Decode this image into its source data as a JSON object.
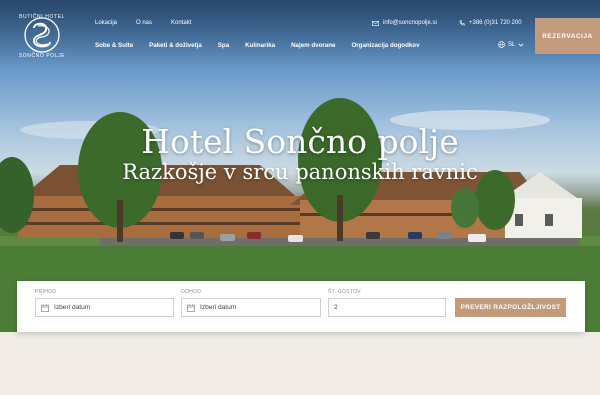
{
  "brand": {
    "logo_top": "Butični hotel",
    "logo_bottom": "Sončno polje"
  },
  "top_links": [
    "Lokacija",
    "O nas",
    "Kontakt"
  ],
  "contact": {
    "email": "info@soncnopolje.si",
    "phone": "+386 (0)31 720 200"
  },
  "nav": [
    "Sobe & Suite",
    "Paketi & doživetja",
    "Spa",
    "Kulinarika",
    "Najem dvorane",
    "Organizacija dogodkov"
  ],
  "language": {
    "current": "SL"
  },
  "cta": {
    "label": "Rezervacija"
  },
  "hero": {
    "title": "Hotel Sončno polje",
    "subtitle": "Razkošje v srcu panonskih ravnic"
  },
  "booking": {
    "arrival_label": "Prihod",
    "arrival_placeholder": "Izberi datum",
    "departure_label": "Odhod",
    "departure_placeholder": "Izberi datum",
    "guests_label": "Št. gostov",
    "guests_value": "2",
    "check_button": "Preveri razpoložljivost"
  },
  "colors": {
    "accent": "#c29a7c",
    "page_background": "#f1ece6"
  }
}
